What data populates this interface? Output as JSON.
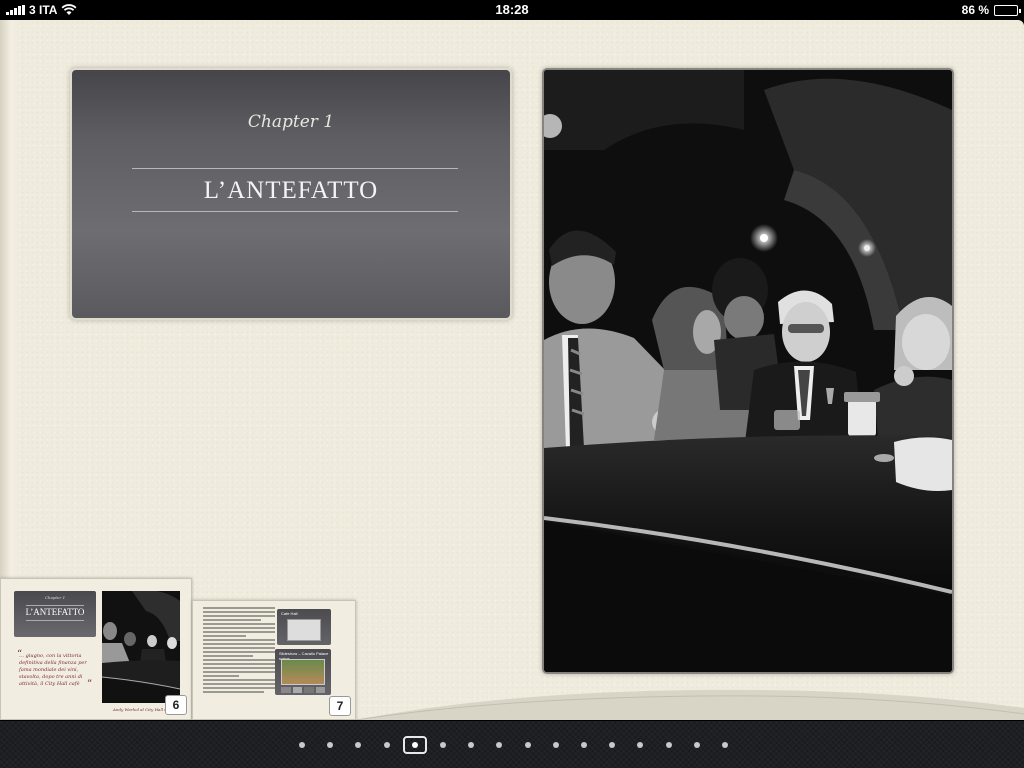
{
  "status_bar": {
    "carrier": "3 ITA",
    "time": "18:28",
    "battery_percent": "86 %",
    "battery_level": 0.86,
    "icons": [
      "signal-icon",
      "wifi-icon",
      "battery-icon"
    ]
  },
  "chapter": {
    "label": "Chapter 1",
    "title": "L’ANTEFATTO"
  },
  "thumbnails": [
    {
      "page": "6",
      "chapter_label": "Chapter 1",
      "title": "L’ANTEFATTO",
      "quote": "… giugno, con la vittoria definitiva della finanza per fama mondiale dei vini, stavolta, dopo tre anni di attività, il City Hall cafè",
      "caption": "Andy Warhol al City Hall Cafè"
    },
    {
      "page": "7",
      "box1_title": "Cafe Hall",
      "box2_title": "Slideshow – Cavallo Palace scrive"
    }
  ],
  "page_dots": {
    "count": 16,
    "active_index": 4
  }
}
